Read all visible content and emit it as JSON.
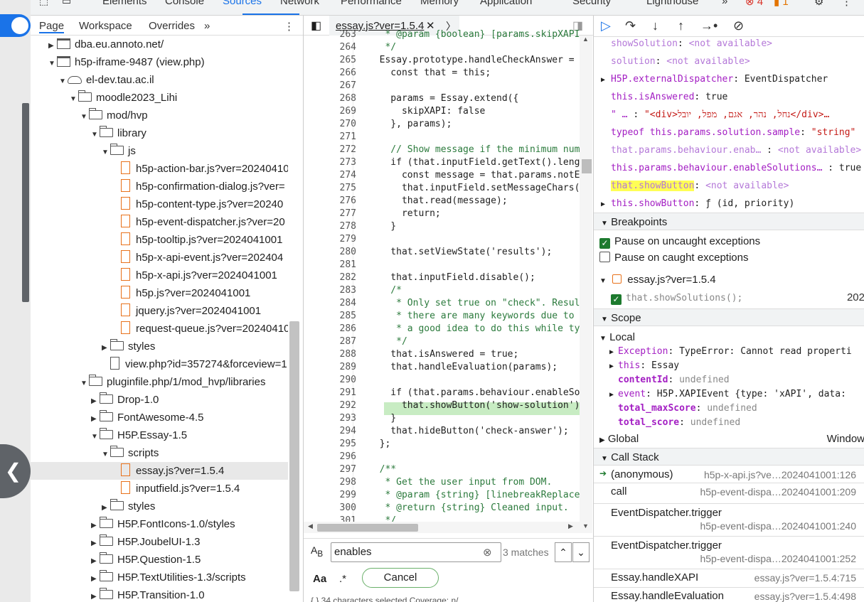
{
  "devtools_tabs": [
    "Elements",
    "Console",
    "Sources",
    "Network",
    "Performance",
    "Memory",
    "Application",
    "Security",
    "Lighthouse"
  ],
  "more": "»",
  "errors": "4",
  "warnings": "1",
  "nav": {
    "tabs": [
      "Page",
      "Workspace",
      "Overrides"
    ],
    "more": "»",
    "tree": [
      {
        "label": "dba.eu.annoto.net/",
        "kind": "frame",
        "indent": 1,
        "tri": "▶"
      },
      {
        "label": "h5p-iframe-9487 (view.php)",
        "kind": "frame",
        "indent": 1,
        "tri": "▼"
      },
      {
        "label": "el-dev.tau.ac.il",
        "kind": "cloud",
        "indent": 2,
        "tri": "▼"
      },
      {
        "label": "moodle2023_Lihi",
        "kind": "folder",
        "indent": 3,
        "tri": "▼"
      },
      {
        "label": "mod/hvp",
        "kind": "folder",
        "indent": 4,
        "tri": "▼"
      },
      {
        "label": "library",
        "kind": "folder",
        "indent": 5,
        "tri": "▼"
      },
      {
        "label": "js",
        "kind": "folder",
        "indent": 6,
        "tri": "▼"
      },
      {
        "label": "h5p-action-bar.js?ver=20240410",
        "kind": "js",
        "indent": 7,
        "tri": ""
      },
      {
        "label": "h5p-confirmation-dialog.js?ver=",
        "kind": "js",
        "indent": 7,
        "tri": ""
      },
      {
        "label": "h5p-content-type.js?ver=20240",
        "kind": "js",
        "indent": 7,
        "tri": ""
      },
      {
        "label": "h5p-event-dispatcher.js?ver=20",
        "kind": "js",
        "indent": 7,
        "tri": ""
      },
      {
        "label": "h5p-tooltip.js?ver=2024041001",
        "kind": "js",
        "indent": 7,
        "tri": ""
      },
      {
        "label": "h5p-x-api-event.js?ver=202404",
        "kind": "js",
        "indent": 7,
        "tri": ""
      },
      {
        "label": "h5p-x-api.js?ver=2024041001",
        "kind": "js",
        "indent": 7,
        "tri": ""
      },
      {
        "label": "h5p.js?ver=2024041001",
        "kind": "js",
        "indent": 7,
        "tri": ""
      },
      {
        "label": "jquery.js?ver=2024041001",
        "kind": "js",
        "indent": 7,
        "tri": ""
      },
      {
        "label": "request-queue.js?ver=20240410",
        "kind": "js",
        "indent": 7,
        "tri": ""
      },
      {
        "label": "styles",
        "kind": "folder",
        "indent": 6,
        "tri": "▶"
      },
      {
        "label": "view.php?id=357274&forceview=1",
        "kind": "file",
        "indent": 6,
        "tri": ""
      },
      {
        "label": "pluginfile.php/1/mod_hvp/libraries",
        "kind": "folder",
        "indent": 4,
        "tri": "▼"
      },
      {
        "label": "Drop-1.0",
        "kind": "folder",
        "indent": 5,
        "tri": "▶"
      },
      {
        "label": "FontAwesome-4.5",
        "kind": "folder",
        "indent": 5,
        "tri": "▶"
      },
      {
        "label": "H5P.Essay-1.5",
        "kind": "folder",
        "indent": 5,
        "tri": "▼"
      },
      {
        "label": "scripts",
        "kind": "folder",
        "indent": 6,
        "tri": "▼"
      },
      {
        "label": "essay.js?ver=1.5.4",
        "kind": "js",
        "indent": 7,
        "tri": "",
        "sel": true
      },
      {
        "label": "inputfield.js?ver=1.5.4",
        "kind": "js",
        "indent": 7,
        "tri": ""
      },
      {
        "label": "styles",
        "kind": "folder",
        "indent": 6,
        "tri": "▶"
      },
      {
        "label": "H5P.FontIcons-1.0/styles",
        "kind": "folder",
        "indent": 5,
        "tri": "▶"
      },
      {
        "label": "H5P.JoubelUI-1.3",
        "kind": "folder",
        "indent": 5,
        "tri": "▶"
      },
      {
        "label": "H5P.Question-1.5",
        "kind": "folder",
        "indent": 5,
        "tri": "▶"
      },
      {
        "label": "H5P.TextUtilities-1.3/scripts",
        "kind": "folder",
        "indent": 5,
        "tri": "▶"
      },
      {
        "label": "H5P.Transition-1.0",
        "kind": "folder",
        "indent": 5,
        "tri": "▶"
      }
    ]
  },
  "editor": {
    "tab": "essay.js?ver=1.5.4",
    "lines": [
      {
        "n": "263",
        "t": "   * @param {boolean} [params.skipXAPI"
      },
      {
        "n": "264",
        "t": "   */"
      },
      {
        "n": "265",
        "t": "  Essay.prototype.handleCheckAnswer = "
      },
      {
        "n": "266",
        "t": "    const that = this;"
      },
      {
        "n": "267",
        "t": ""
      },
      {
        "n": "268",
        "t": "    params = Essay.extend({"
      },
      {
        "n": "269",
        "t": "      skipXAPI: false"
      },
      {
        "n": "270",
        "t": "    }, params);"
      },
      {
        "n": "271",
        "t": ""
      },
      {
        "n": "272",
        "t": "    // Show message if the minimum num"
      },
      {
        "n": "273",
        "t": "    if (that.inputField.getText().leng"
      },
      {
        "n": "274",
        "t": "      const message = that.params.notE"
      },
      {
        "n": "275",
        "t": "      that.inputField.setMessageChars("
      },
      {
        "n": "276",
        "t": "      that.read(message);"
      },
      {
        "n": "277",
        "t": "      return;"
      },
      {
        "n": "278",
        "t": "    }"
      },
      {
        "n": "279",
        "t": ""
      },
      {
        "n": "280",
        "t": "    that.setViewState('results');"
      },
      {
        "n": "281",
        "t": ""
      },
      {
        "n": "282",
        "t": "    that.inputField.disable();"
      },
      {
        "n": "283",
        "t": "    /*"
      },
      {
        "n": "284",
        "t": "     * Only set true on \"check\". Resul"
      },
      {
        "n": "285",
        "t": "     * there are many keywords due to "
      },
      {
        "n": "286",
        "t": "     * a good idea to do this while ty"
      },
      {
        "n": "287",
        "t": "     */"
      },
      {
        "n": "288",
        "t": "    that.isAnswered = true;"
      },
      {
        "n": "289",
        "t": "    that.handleEvaluation(params);"
      },
      {
        "n": "290",
        "t": ""
      },
      {
        "n": "291",
        "t": "    if (that.params.behaviour.enableSo"
      },
      {
        "n": "292",
        "t": "      that.showButton('show-solution')"
      },
      {
        "n": "293",
        "t": "    }"
      },
      {
        "n": "294",
        "t": "    that.hideButton('check-answer');"
      },
      {
        "n": "295",
        "t": "  };"
      },
      {
        "n": "296",
        "t": ""
      },
      {
        "n": "297",
        "t": "  /**"
      },
      {
        "n": "298",
        "t": "   * Get the user input from DOM."
      },
      {
        "n": "299",
        "t": "   * @param {string} [linebreakReplace"
      },
      {
        "n": "300",
        "t": "   * @return {string} Cleaned input."
      },
      {
        "n": "301",
        "t": "   */"
      }
    ],
    "search": {
      "aa": "Aa",
      "regex": ".*",
      "case": "A",
      "value": "enables",
      "matches": "3 matches",
      "cancel": "Cancel",
      "footer": "{ }  34 characters selected    Coverage: n/"
    }
  },
  "watch": [
    {
      "k": "showSolution",
      "v": "<not available>",
      "cls": "lav",
      "tri": ""
    },
    {
      "k": "solution",
      "v": "<not available>",
      "cls": "lav",
      "tri": ""
    },
    {
      "k": "H5P.externalDispatcher",
      "v": "EventDispatcher",
      "cls": "",
      "tri": "▶"
    },
    {
      "k": "this.isAnswered",
      "v": "true",
      "cls": "",
      "tri": ""
    },
    {
      "k": "\" … ",
      "v": "\"<div>נחל, נהר, אגם, מפל, יובל</div>…",
      "cls": "st",
      "tri": ""
    },
    {
      "k": "typeof this.params.solution.sample",
      "v": "\"string\"",
      "cls": "st",
      "tri": ""
    },
    {
      "k": "that.params.behaviour.enab… ",
      "v": "<not available>",
      "cls": "lav",
      "tri": ""
    },
    {
      "k": "this.params.behaviour.enableSolutions… ",
      "v": "true",
      "cls": "",
      "tri": ""
    },
    {
      "k": "that.showButton",
      "v": "<not available>",
      "cls": "lav",
      "tri": ""
    },
    {
      "k": "this.showButton",
      "v": "ƒ (id, priority)",
      "cls": "",
      "tri": "▶"
    }
  ],
  "breakpoints": {
    "title": "Breakpoints",
    "uncaught": "Pause on uncaught exceptions",
    "caught": "Pause on caught exceptions",
    "file": "essay.js?ver=1.5.4",
    "item": "that.showSolutions();",
    "line": "202"
  },
  "scope": {
    "title": "Scope",
    "local": "Local",
    "vars": [
      {
        "k": "Exception",
        "v": "TypeError: Cannot read properti",
        "tri": "▶"
      },
      {
        "k": "this",
        "v": "Essay",
        "tri": "▶"
      },
      {
        "k": "contentId",
        "v": "undefined",
        "tri": ""
      },
      {
        "k": "event",
        "v": "H5P.XAPIEvent {type: 'xAPI', data:",
        "tri": "▶"
      },
      {
        "k": "total_maxScore",
        "v": "undefined",
        "tri": ""
      },
      {
        "k": "total_score",
        "v": "undefined",
        "tri": ""
      }
    ],
    "global": "Global",
    "global_val": "Window"
  },
  "callstack": {
    "title": "Call Stack",
    "frames": [
      {
        "fn": "(anonymous)",
        "loc": "h5p-x-api.js?ve…2024041001:126"
      },
      {
        "fn": "call",
        "loc": "h5p-event-dispa…2024041001:209"
      },
      {
        "fn": "EventDispatcher.trigger",
        "loc": "h5p-event-dispa…2024041001:240"
      },
      {
        "fn": "EventDispatcher.trigger",
        "loc": "h5p-event-dispa…2024041001:252"
      },
      {
        "fn": "Essay.handleXAPI",
        "loc": "essay.js?ver=1.5.4:715"
      },
      {
        "fn": "Essay.handleEvaluation",
        "loc": "essay.js?ver=1.5.4:498"
      }
    ]
  }
}
